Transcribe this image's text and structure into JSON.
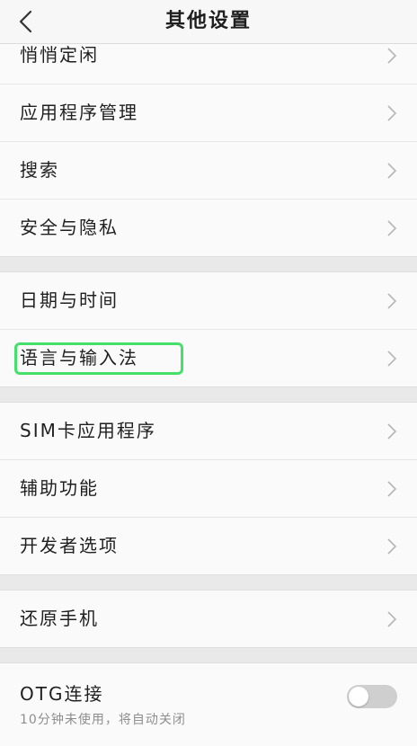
{
  "header": {
    "title": "其他设置"
  },
  "groups": [
    {
      "items": [
        {
          "label": "悄悄定闲"
        },
        {
          "label": "应用程序管理"
        },
        {
          "label": "搜索"
        },
        {
          "label": "安全与隐私"
        }
      ]
    },
    {
      "items": [
        {
          "label": "日期与时间"
        },
        {
          "label": "语言与输入法"
        }
      ]
    },
    {
      "items": [
        {
          "label": "SIM卡应用程序"
        },
        {
          "label": "辅助功能"
        },
        {
          "label": "开发者选项"
        }
      ]
    },
    {
      "items": [
        {
          "label": "还原手机"
        }
      ]
    }
  ],
  "otg": {
    "title": "OTG连接",
    "subtitle": "10分钟未使用，将自动关闭",
    "enabled": false
  },
  "colors": {
    "highlight": "#45e06a",
    "toggle_off": "#cfcfcf"
  }
}
